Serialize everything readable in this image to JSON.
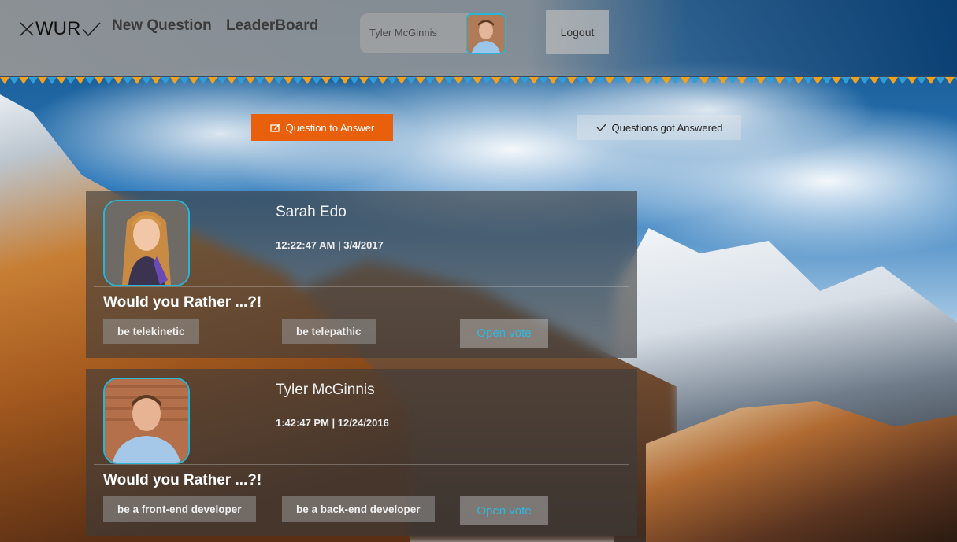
{
  "header": {
    "logo_text": "WUR",
    "nav": [
      {
        "label": "New Question"
      },
      {
        "label": "LeaderBoard"
      }
    ],
    "user": {
      "name": "Tyler McGinnis"
    },
    "logout_label": "Logout"
  },
  "tabs": {
    "active_label": "Question to Answer",
    "inactive_label": "Questions got Answered"
  },
  "questions": [
    {
      "author": "Sarah Edo",
      "timestamp": "12:22:47 AM | 3/4/2017",
      "title": "Would you Rather ...?!",
      "option_one": "be telekinetic",
      "option_two": "be telepathic",
      "vote_label": "Open vote"
    },
    {
      "author": "Tyler McGinnis",
      "timestamp": "1:42:47 PM | 12/24/2016",
      "title": "Would you Rather ...?!",
      "option_one": "be a front-end developer",
      "option_two": "be a back-end developer",
      "vote_label": "Open vote"
    }
  ],
  "colors": {
    "accent": "#e8600c",
    "avatar_border": "#2ab4d8",
    "vote_text": "#2fb8df"
  }
}
